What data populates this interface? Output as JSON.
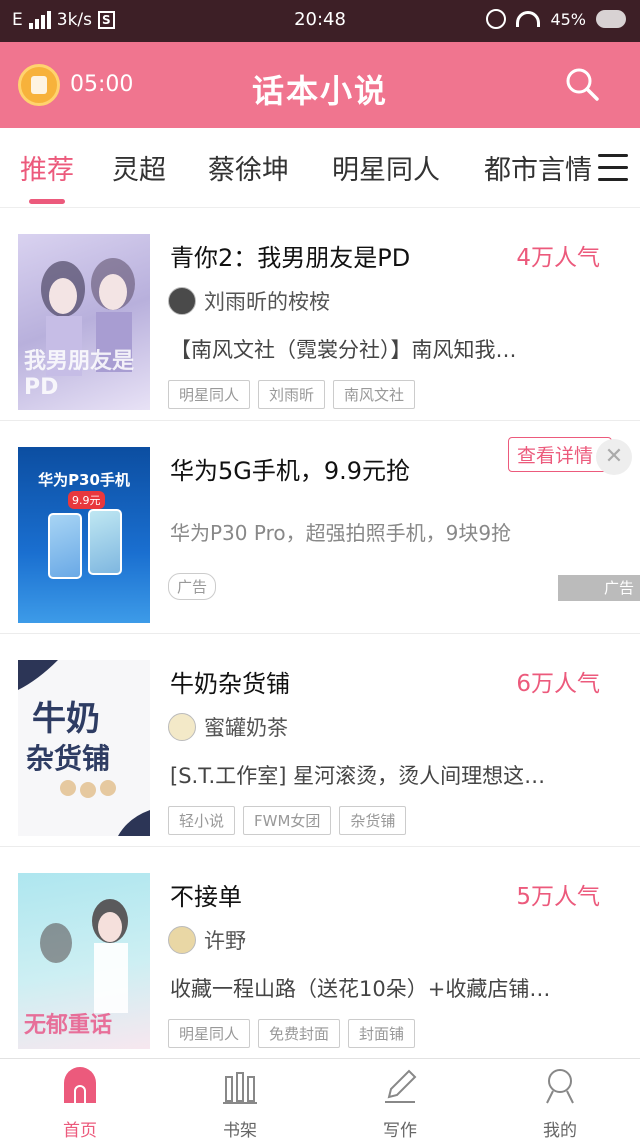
{
  "status_bar": {
    "network": "E",
    "speed": "3k/s",
    "s_badge": "S",
    "time": "20:48",
    "battery": "45%"
  },
  "header": {
    "timer": "05:00",
    "title": "话本小说"
  },
  "tabs": [
    {
      "label": "推荐",
      "active": true
    },
    {
      "label": "灵超"
    },
    {
      "label": "蔡徐坤"
    },
    {
      "label": "明星同人"
    },
    {
      "label": "都市言情"
    }
  ],
  "items": [
    {
      "title": "青你2：我男朋友是PD",
      "popularity": "4万人气",
      "author": "刘雨昕的桉桉",
      "desc": "【南风文社（霓裳分社）】南风知我…",
      "tags": [
        "明星同人",
        "刘雨昕",
        "南风文社"
      ],
      "cover_text": "我男朋友是PD"
    },
    {
      "title": "华为5G手机，9.9元抢",
      "detail": "查看详情",
      "desc": "华为P30 Pro，超强拍照手机，9块9抢",
      "ad_tag": "广告",
      "ad_corner": "广告",
      "cover_text": "华为P30手机",
      "cover_price": "9.9元"
    },
    {
      "title": "牛奶杂货铺",
      "popularity": "6万人气",
      "author": "蜜罐奶茶",
      "desc": "[S.T.工作室] 星河滚烫，烫人间理想这…",
      "tags": [
        "轻小说",
        "FWM女团",
        "杂货铺"
      ],
      "cover_text": "牛奶杂货铺"
    },
    {
      "title": "不接单",
      "popularity": "5万人气",
      "author": "许野",
      "desc": "收藏一程山路（送花10朵）+收藏店铺…",
      "tags": [
        "明星同人",
        "免费封面",
        "封面铺"
      ],
      "cover_text": "无郁重话"
    }
  ],
  "bottom_nav": [
    {
      "label": "首页",
      "active": true
    },
    {
      "label": "书架"
    },
    {
      "label": "写作"
    },
    {
      "label": "我的"
    }
  ],
  "colors": {
    "accent": "#ec5a7c",
    "header_bg": "#f0758f",
    "status_bg": "#3d1f26"
  }
}
